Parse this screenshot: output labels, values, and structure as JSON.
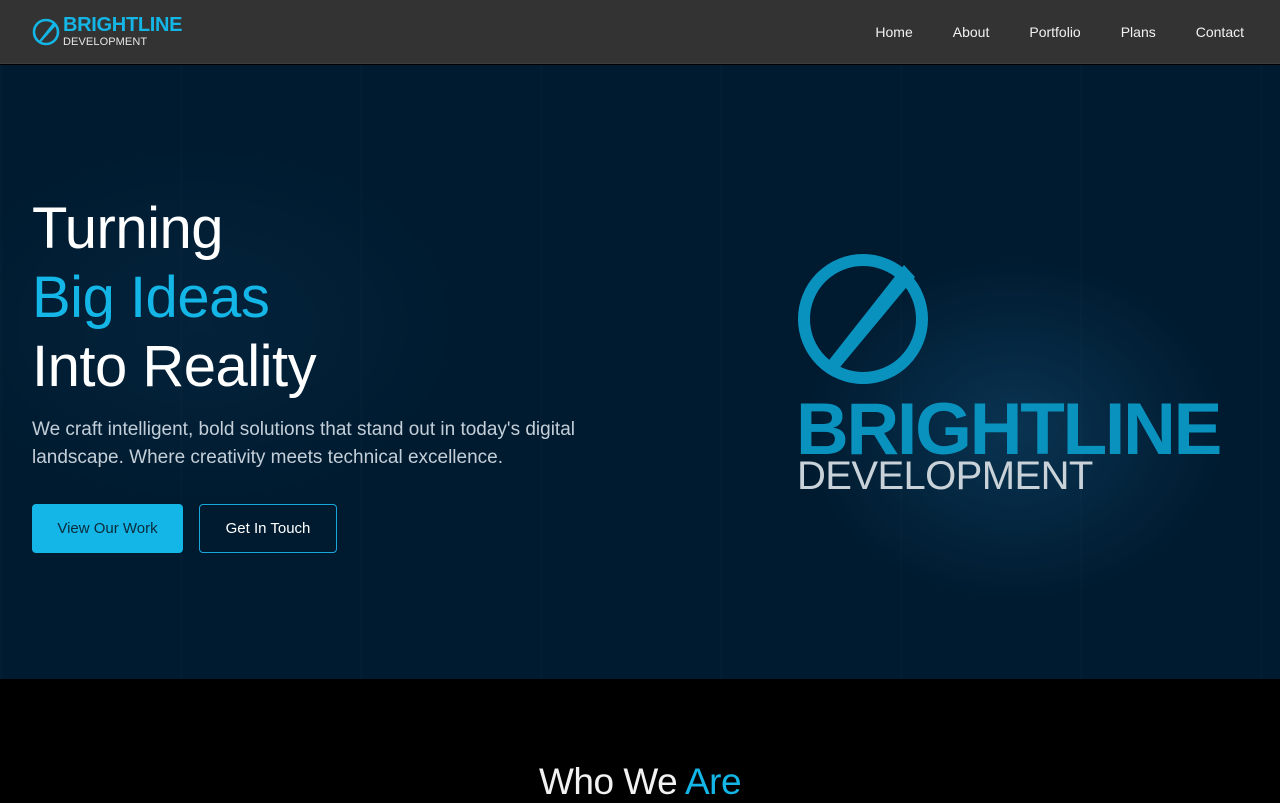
{
  "header": {
    "logo": {
      "name": "BRIGHTLINE",
      "sub": "DEVELOPMENT"
    },
    "nav": [
      {
        "label": "Home"
      },
      {
        "label": "About"
      },
      {
        "label": "Portfolio"
      },
      {
        "label": "Plans"
      },
      {
        "label": "Contact"
      }
    ]
  },
  "hero": {
    "headline": {
      "line1": "Turning",
      "line2": "Big Ideas",
      "line3": "Into Reality"
    },
    "subtext": "We craft intelligent, bold solutions that stand out in today's digital landscape. Where creativity meets technical excellence.",
    "primary_button": "View Our Work",
    "secondary_button": "Get In Touch",
    "brand_logo": {
      "name": "BRIGHTLINE",
      "sub": "DEVELOPMENT"
    }
  },
  "about_section": {
    "title_part1": "Who We",
    "title_part2": "Are"
  },
  "colors": {
    "accent": "#13b6e6",
    "header_bg": "#333333",
    "hero_bg": "#001b30",
    "page_bg": "#000000"
  }
}
